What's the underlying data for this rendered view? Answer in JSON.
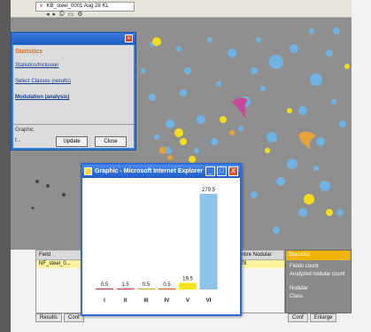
{
  "browser_tab": {
    "title": "KB_steel_0001 Aug 28 KL",
    "close_glyph": "x"
  },
  "toolbar": {
    "icons": [
      "back-icon",
      "forward-icon",
      "print-icon",
      "page-icon",
      "tools-icon"
    ]
  },
  "stats_dialog": {
    "heading": "Statistics",
    "links": [
      "Statistics/Inclusion",
      "Select Classes (results)",
      "Modulation (analysis)",
      "Graphic"
    ],
    "update_label": "Update",
    "close_label": "Close",
    "footer_text": "f..."
  },
  "grid": {
    "columns": [
      "Field",
      "",
      "",
      "",
      "",
      "Entire Nodular"
    ],
    "row": [
      "NF_steel_0...",
      "",
      "",
      "",
      "",
      "278"
    ],
    "tabs": [
      "Results",
      "Conf"
    ]
  },
  "right_pane": {
    "title": "Statistics",
    "lines": [
      "Fields count",
      "Analyzed nodular count",
      "Nodular",
      "Class"
    ],
    "tabs": [
      "Conf",
      "Enlarge"
    ]
  },
  "graphic_window": {
    "title": "Graphic - Microsoft Internet Explorer",
    "minimize": "_",
    "maximize": "□",
    "close": "X"
  },
  "chart_data": {
    "type": "bar",
    "categories": [
      "I",
      "II",
      "III",
      "IV",
      "V",
      "VI"
    ],
    "values": [
      0.5,
      1.5,
      0.5,
      0.5,
      19.5,
      279.5
    ],
    "value_labels": [
      "0.5",
      "1.5",
      "0.5",
      "0.5",
      "19.5",
      "279.5"
    ],
    "colors": [
      "#b04848",
      "#b04848",
      "#d4a437",
      "#c86a2c",
      "#f5e51c",
      "#8ec3ea"
    ],
    "ylim": [
      0,
      300
    ],
    "grid": false
  }
}
